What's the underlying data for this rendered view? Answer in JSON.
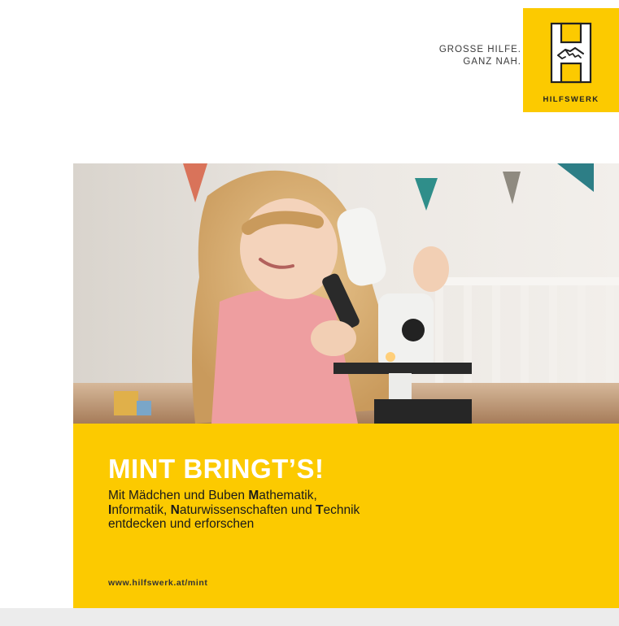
{
  "header": {
    "tagline_line1": "GROSSE HILFE.",
    "tagline_line2": "GANZ NAH."
  },
  "logo": {
    "name": "HILFSWERK",
    "icon": "hilfswerk-h-handshake-icon",
    "background_color": "#fcca00"
  },
  "photo": {
    "subject": "girl-with-microscope-photo"
  },
  "panel": {
    "background_color": "#fcca00",
    "headline": "MINT BRINGT’S!",
    "lines": [
      {
        "parts": [
          {
            "text": "Mit Mädchen und Buben ",
            "bold": false
          },
          {
            "text": "M",
            "bold": true
          },
          {
            "text": "athematik,",
            "bold": false
          }
        ]
      },
      {
        "parts": [
          {
            "text": "I",
            "bold": true
          },
          {
            "text": "nformatik, ",
            "bold": false
          },
          {
            "text": "N",
            "bold": true
          },
          {
            "text": "aturwissenschaften und ",
            "bold": false
          },
          {
            "text": "T",
            "bold": true
          },
          {
            "text": "echnik",
            "bold": false
          }
        ]
      },
      {
        "parts": [
          {
            "text": "entdecken und erforschen",
            "bold": false
          }
        ]
      }
    ],
    "url": "www.hilfswerk.at/mint"
  }
}
